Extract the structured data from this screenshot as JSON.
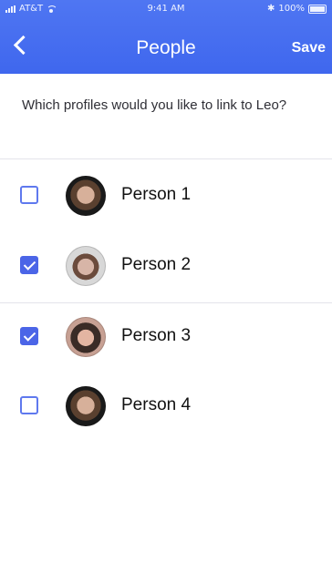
{
  "status_bar": {
    "carrier": "AT&T",
    "time": "9:41 AM",
    "battery": "100%"
  },
  "header": {
    "title": "People",
    "save_label": "Save"
  },
  "prompt": "Which profiles would you like to link to Leo?",
  "profiles": [
    {
      "name": "Person 1",
      "checked": false
    },
    {
      "name": "Person 2",
      "checked": true
    },
    {
      "name": "Person 3",
      "checked": true
    },
    {
      "name": "Person 4",
      "checked": false
    }
  ],
  "colors": {
    "header": "#4b6ff0",
    "checkbox": "#4b65e7"
  }
}
